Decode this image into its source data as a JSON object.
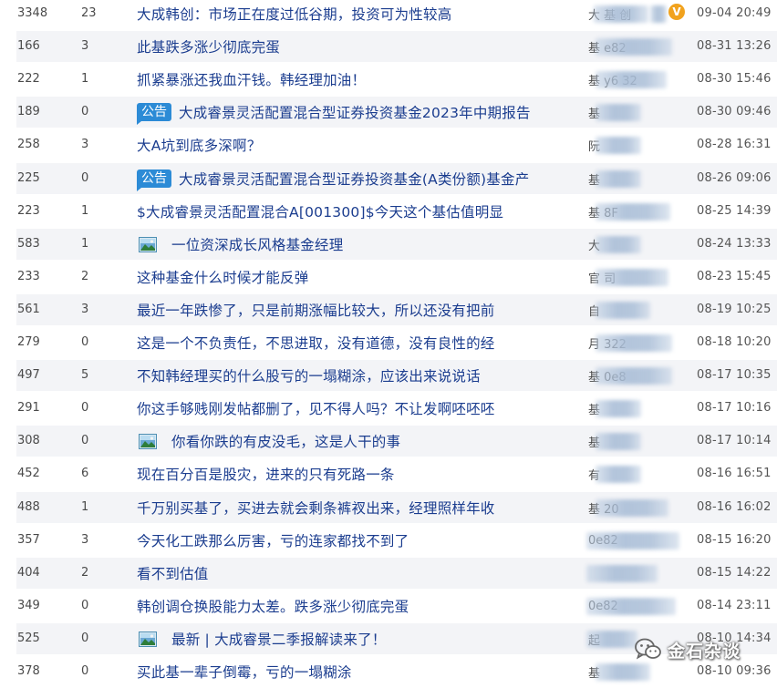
{
  "rows": [
    {
      "reads": "3348",
      "replies": "23",
      "title": "大成韩创：市场正在度过低谷期，投资可为性较高",
      "tag": "",
      "author_visible": "大 基  创",
      "verified": true,
      "time": "09-04 20:49"
    },
    {
      "reads": "166",
      "replies": "3",
      "title": "此基跌多涨少彻底完蛋",
      "tag": "",
      "author_visible": "基   e82",
      "verified": false,
      "time": "08-31 13:26"
    },
    {
      "reads": "222",
      "replies": "1",
      "title": "抓紧暴涨还我血汗钱。韩经理加油！",
      "tag": "",
      "author_visible": "基   y6  32",
      "verified": false,
      "time": "08-30 15:46"
    },
    {
      "reads": "189",
      "replies": "0",
      "title": "大成睿景灵活配置混合型证券投资基金2023年中期报告",
      "tag": "公告",
      "author_visible": "基",
      "verified": false,
      "time": "08-30 09:46"
    },
    {
      "reads": "258",
      "replies": "3",
      "title": "大A坑到底多深啊？",
      "tag": "",
      "author_visible": "阮",
      "verified": false,
      "time": "08-28 16:31"
    },
    {
      "reads": "225",
      "replies": "0",
      "title": "大成睿景灵活配置混合型证券投资基金(A类份额)基金产",
      "tag": "公告",
      "author_visible": "基",
      "verified": false,
      "time": "08-26 09:06"
    },
    {
      "reads": "223",
      "replies": "1",
      "title": "$大成睿景灵活配置混合A[001300]$今天这个基估值明显",
      "tag": "",
      "author_visible": "基        8F",
      "verified": false,
      "time": "08-25 14:39"
    },
    {
      "reads": "583",
      "replies": "1",
      "title": "一位资深成长风格基金经理",
      "tag": "image",
      "author_visible": "大",
      "verified": false,
      "time": "08-24 13:33"
    },
    {
      "reads": "233",
      "replies": "2",
      "title": "这种基金什么时候才能反弹",
      "tag": "",
      "author_visible": "官       司",
      "verified": false,
      "time": "08-23 15:45"
    },
    {
      "reads": "561",
      "replies": "3",
      "title": "最近一年跌惨了，只是前期涨幅比较大，所以还没有把前",
      "tag": "",
      "author_visible": "自",
      "verified": false,
      "time": "08-19 10:25"
    },
    {
      "reads": "279",
      "replies": "0",
      "title": "这是一个不负责任，不思进取，没有道德，没有良性的经",
      "tag": "",
      "author_visible": "月       322",
      "verified": false,
      "time": "08-18 10:20"
    },
    {
      "reads": "497",
      "replies": "5",
      "title": "不知韩经理买的什么股亏的一塌糊涂，应该出来说说话",
      "tag": "",
      "author_visible": "基       0e8",
      "verified": false,
      "time": "08-17 10:35"
    },
    {
      "reads": "291",
      "replies": "0",
      "title": "你这手够贱刚发帖都删了，见不得人吗？不让发啊呸呸呸",
      "tag": "",
      "author_visible": "基",
      "verified": false,
      "time": "08-17 10:16"
    },
    {
      "reads": "308",
      "replies": "0",
      "title": "你看你跌的有皮没毛，这是人干的事",
      "tag": "image",
      "author_visible": "基",
      "verified": false,
      "time": "08-17 10:14"
    },
    {
      "reads": "452",
      "replies": "6",
      "title": "现在百分百是股灾，进来的只有死路一条",
      "tag": "",
      "author_visible": "有",
      "verified": false,
      "time": "08-16 16:51"
    },
    {
      "reads": "488",
      "replies": "1",
      "title": "千万别买基了，买进去就会剩条裤衩出来，经理照样年收",
      "tag": "",
      "author_visible": "基        20",
      "verified": false,
      "time": "08-16 16:02"
    },
    {
      "reads": "357",
      "replies": "3",
      "title": "今天化工跌那么厉害，亏的连家都找不到了",
      "tag": "",
      "author_visible": "        0e82",
      "verified": false,
      "time": "08-15 16:20"
    },
    {
      "reads": "404",
      "replies": "2",
      "title": "看不到估值",
      "tag": "",
      "author_visible": "",
      "verified": false,
      "time": "08-15 14:22"
    },
    {
      "reads": "349",
      "replies": "0",
      "title": "韩创调仓换股能力太差。跌多涨少彻底完蛋",
      "tag": "",
      "author_visible": "        0e82",
      "verified": false,
      "time": "08-14 23:11"
    },
    {
      "reads": "525",
      "replies": "0",
      "title": "最新 | 大成睿景二季报解读来了！",
      "tag": "image",
      "author_visible": "     起",
      "verified": false,
      "time": "08-10 14:34"
    },
    {
      "reads": "378",
      "replies": "0",
      "title": "买此基一辈子倒霉，亏的一塌糊涂",
      "tag": "",
      "author_visible": "基    ",
      "verified": false,
      "time": "08-10 09:36"
    }
  ],
  "tag_label": "公告",
  "verified_mark": "V",
  "watermark": "金石杂谈",
  "colors": {
    "title": "#1b3d8f",
    "badge": "#2c8bd6",
    "alt_row": "#f3f4f7",
    "verified": "#f1a21d"
  }
}
